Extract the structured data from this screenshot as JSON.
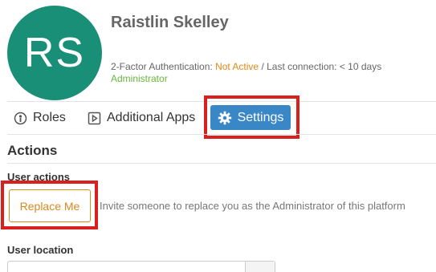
{
  "user": {
    "initials": "RS",
    "name": "Raistlin Skelley",
    "twofa_label": "2-Factor Authentication: ",
    "twofa_status": "Not Active",
    "last_connection": " / Last connection: < 10 days",
    "role": "Administrator"
  },
  "tabs": [
    {
      "label": "Roles",
      "icon": "roles-icon"
    },
    {
      "label": "Additional Apps",
      "icon": "apps-icon"
    },
    {
      "label": "Settings",
      "icon": "gear-icon",
      "active": true
    }
  ],
  "actions": {
    "title": "Actions",
    "user_actions_label": "User actions",
    "replace_button": "Replace Me",
    "replace_description": "Invite someone to replace you as the Administrator of this platform",
    "user_location_label": "User location"
  },
  "colors": {
    "avatar": "#1a8f78",
    "active_tab": "#3a87c8",
    "warning": "#e08a16",
    "role": "#6ab43e",
    "highlight": "#d91f1f"
  }
}
